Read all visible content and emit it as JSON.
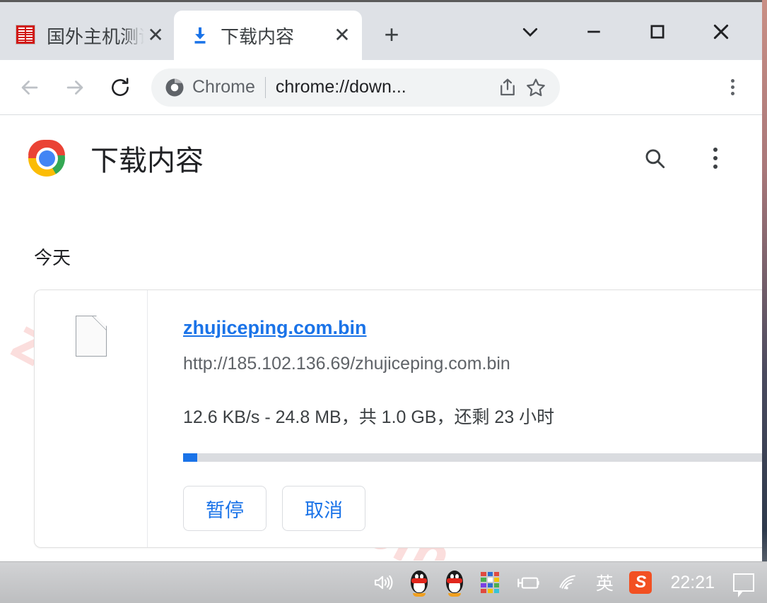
{
  "window": {
    "controls": {
      "tab_search": "tab-search-chevron",
      "minimize": "minimize",
      "maximize": "maximize",
      "close": "close"
    }
  },
  "tabs": [
    {
      "title": "国外主机测评",
      "favicon": "red-square-favicon",
      "active": false,
      "close_label": "✕"
    },
    {
      "title": "下载内容",
      "favicon": "download-icon",
      "active": true,
      "close_label": "✕"
    }
  ],
  "newtab": {
    "label": "+"
  },
  "toolbar": {
    "back": "←",
    "forward": "→",
    "reload": "⟳",
    "omnibox": {
      "chip_label": "Chrome",
      "url": "chrome://down...",
      "share_icon": "share-icon",
      "bookmark_icon": "star-icon"
    },
    "menu": "chrome-menu-icon"
  },
  "page": {
    "logo": "chrome-logo",
    "title": "下载内容",
    "search_icon": "search-icon",
    "menu_icon": "more-vertical-icon",
    "watermark": "zhujiceping.com",
    "group_label": "今天",
    "download": {
      "file_icon": "generic-file-icon",
      "file_name": "zhujiceping.com.bin",
      "file_url": "http://185.102.136.69/zhujiceping.com.bin",
      "status": "12.6 KB/s - 24.8 MB，共 1.0 GB，还剩 23 小时",
      "progress_percent": 2.4,
      "pause_label": "暂停",
      "cancel_label": "取消"
    }
  },
  "taskbar": {
    "clock": "22:21",
    "ime": "英",
    "sogou": "S",
    "items": [
      "volume-icon",
      "qq-icon",
      "qq-icon-2",
      "color-grid-icon",
      "battery-icon",
      "wifi-icon",
      "ime-indicator",
      "sogou-input-icon",
      "clock",
      "notification-icon"
    ]
  },
  "colors": {
    "accent_blue": "#1a73e8",
    "tabstrip_gray": "#dee1e6",
    "watermark_pink": "#fbdedd",
    "taskbar_gray": "#c6c7c9"
  }
}
